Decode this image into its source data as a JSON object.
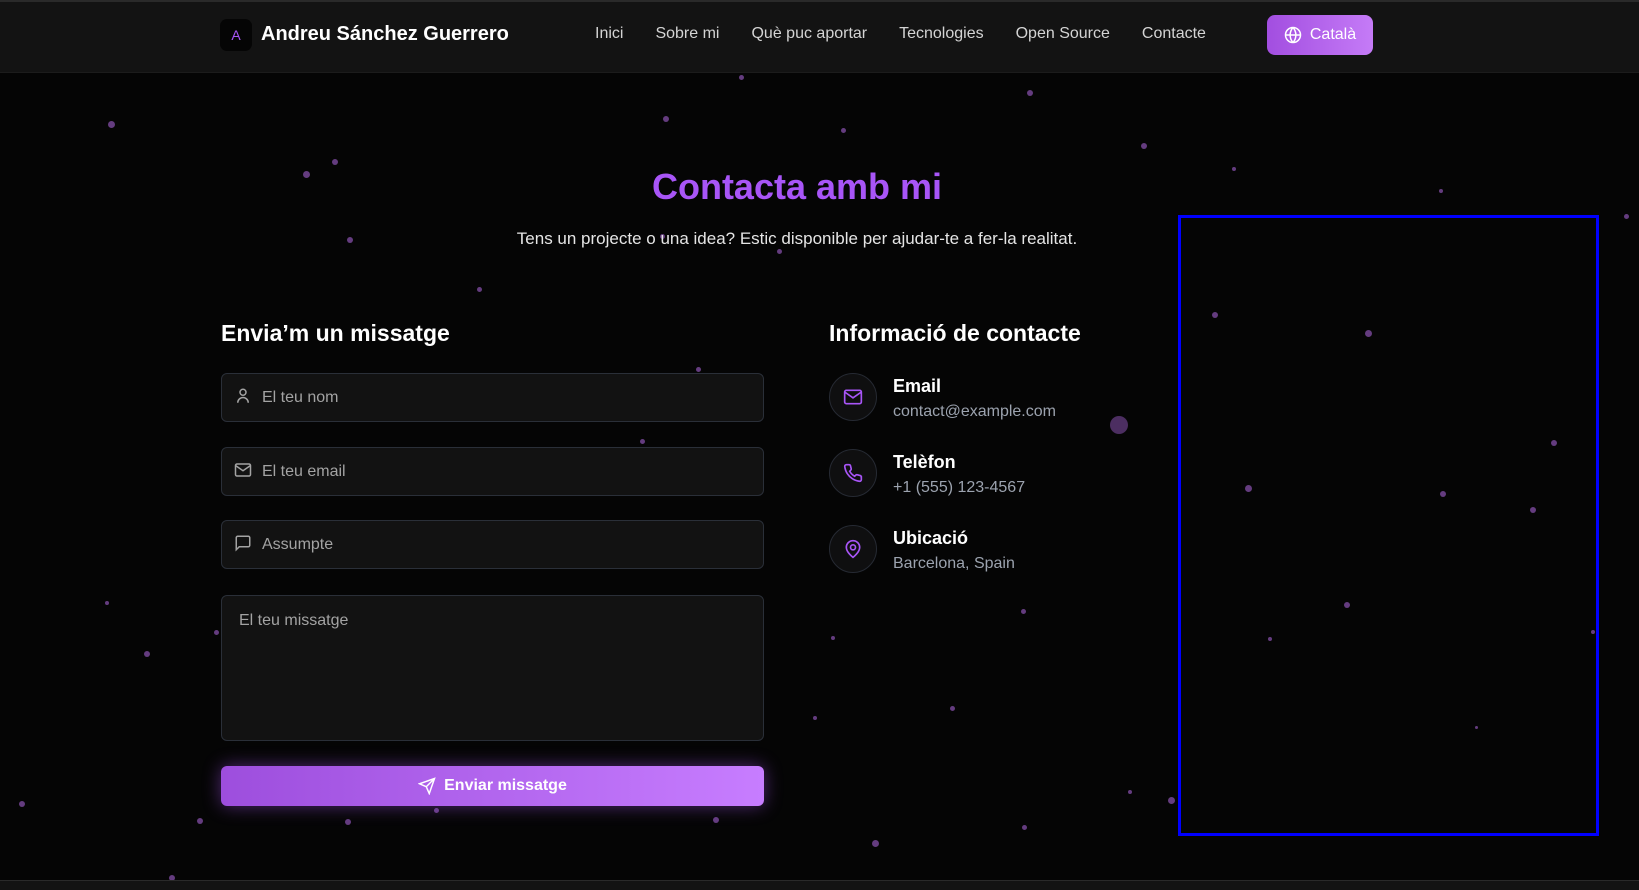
{
  "nav": {
    "logo_letter": "A",
    "brand": "Andreu Sánchez Guerrero",
    "links": [
      "Inici",
      "Sobre mi",
      "Què puc aportar",
      "Tecnologies",
      "Open Source",
      "Contacte"
    ],
    "language": "Català"
  },
  "hero": {
    "title": "Contacta amb mi",
    "subtitle": "Tens un projecte o una idea? Estic disponible per ajudar-te a fer-la realitat."
  },
  "form": {
    "heading": "Envia’m un missatge",
    "name_placeholder": "El teu nom",
    "email_placeholder": "El teu email",
    "subject_placeholder": "Assumpte",
    "message_placeholder": "El teu missatge",
    "submit": "Enviar missatge"
  },
  "info": {
    "heading": "Informació de contacte",
    "items": [
      {
        "icon": "mail-icon",
        "label": "Email",
        "value": "contact@example.com"
      },
      {
        "icon": "phone-icon",
        "label": "Telèfon",
        "value": "+1 (555) 123-4567"
      },
      {
        "icon": "map-pin-icon",
        "label": "Ubicació",
        "value": "Barcelona, Spain"
      }
    ]
  },
  "colors": {
    "accent": "#a855f7",
    "background": "#050505",
    "highlight_box": "#0000ff"
  }
}
